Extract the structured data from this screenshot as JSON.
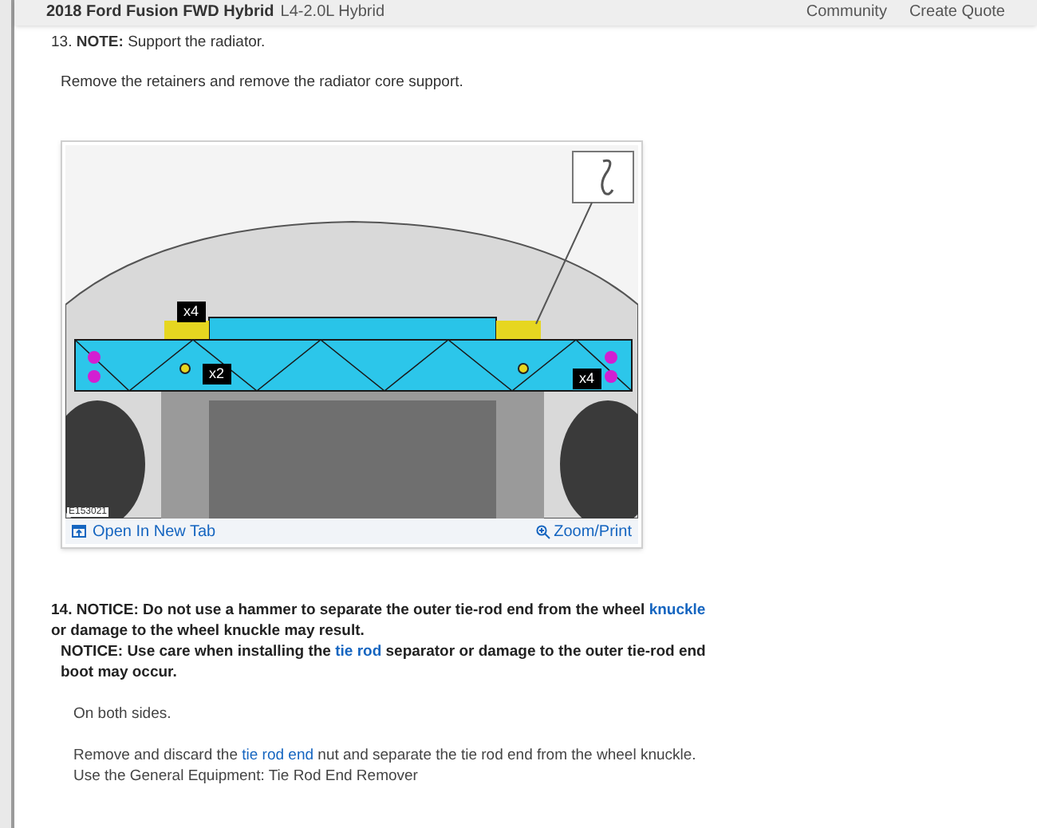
{
  "header": {
    "title": "2018 Ford Fusion FWD Hybrid",
    "subtitle": "L4-2.0L Hybrid",
    "actions": [
      "Community",
      "Create Quote"
    ]
  },
  "steps": [
    {
      "number": "13.",
      "note_label": "NOTE:",
      "note": "Support the radiator.",
      "instructions": [
        "Remove the retainers and remove the radiator core support."
      ],
      "figure": {
        "id_label": "E153021",
        "callouts": [
          "x4",
          "x2",
          "x4"
        ],
        "open_link": "Open In New Tab",
        "zoom_link": "Zoom/Print"
      }
    },
    {
      "number": "14.",
      "notices": [
        {
          "parts": [
            {
              "text": "NOTICE: Do not use a hammer to separate the outer tie-rod end from the wheel ",
              "link": false
            },
            {
              "text": "knuckle",
              "link": true
            },
            {
              "text": " or damage to the wheel knuckle may result.",
              "link": false
            }
          ]
        },
        {
          "parts": [
            {
              "text": "NOTICE: Use care when installing the ",
              "link": false
            },
            {
              "text": "tie rod",
              "link": true
            },
            {
              "text": " separator or damage to the outer tie-rod end boot may occur.",
              "link": false
            }
          ]
        }
      ],
      "paragraphs": [
        {
          "parts": [
            {
              "text": "On both sides.",
              "link": false
            }
          ]
        },
        {
          "parts": [
            {
              "text": "Remove and discard the ",
              "link": false
            },
            {
              "text": "tie rod end",
              "link": true
            },
            {
              "text": " nut and separate the tie rod end from the wheel knuckle.",
              "link": false
            }
          ]
        },
        {
          "parts": [
            {
              "text": "Use the General Equipment: Tie Rod End Remover",
              "link": false
            }
          ]
        }
      ]
    }
  ]
}
